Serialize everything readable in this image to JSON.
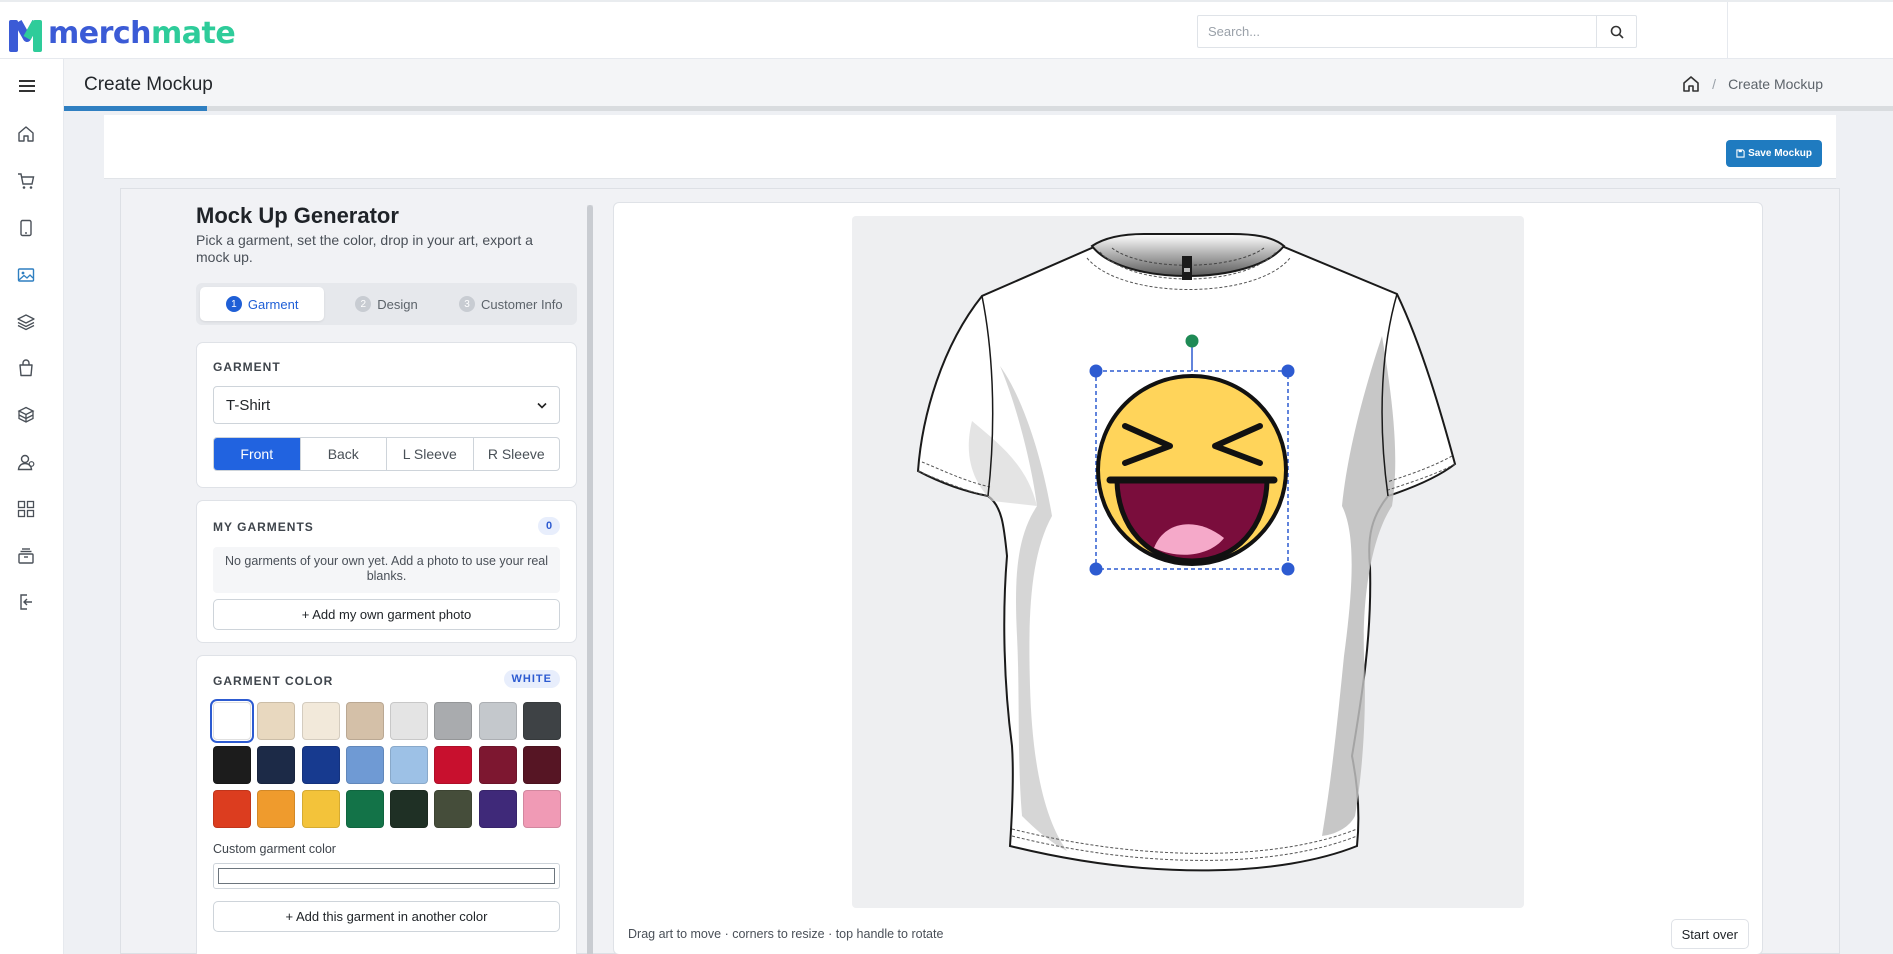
{
  "app": {
    "logo_part1": "merch",
    "logo_part2": "mate",
    "brand_primary": "#3b5bd6",
    "brand_secondary": "#2ecc9a"
  },
  "search": {
    "placeholder": "Search...",
    "icon": "search-icon"
  },
  "sidebar": {
    "items": [
      {
        "icon": "home-icon"
      },
      {
        "icon": "cart-icon"
      },
      {
        "icon": "tablet-icon"
      },
      {
        "icon": "image-icon",
        "active": true
      },
      {
        "icon": "layers-icon"
      },
      {
        "icon": "bag-icon"
      },
      {
        "icon": "stack-icon"
      },
      {
        "icon": "users-icon"
      },
      {
        "icon": "grid-icon"
      },
      {
        "icon": "archive-icon"
      },
      {
        "icon": "logout-icon"
      }
    ]
  },
  "page": {
    "title": "Create Mockup",
    "breadcrumb_home_icon": "home-icon",
    "breadcrumb_current": "Create Mockup",
    "progress_fraction": 0.078
  },
  "toolbar": {
    "save_label": "Save Mockup"
  },
  "generator": {
    "title": "Mock Up Generator",
    "subtitle": "Pick a garment, set the color, drop in your art, export a mock up.",
    "steps": [
      {
        "num": "1",
        "label": "Garment",
        "active": true
      },
      {
        "num": "2",
        "label": "Design"
      },
      {
        "num": "3",
        "label": "Customer Info"
      }
    ]
  },
  "garment": {
    "label": "GARMENT",
    "selected": "T-Shirt",
    "views": [
      "Front",
      "Back",
      "L Sleeve",
      "R Sleeve"
    ],
    "active_view": "Front"
  },
  "my_garments": {
    "label": "MY GARMENTS",
    "count": "0",
    "empty_text": "No garments of your own yet. Add a photo to use your real blanks.",
    "add_button": "+ Add my own garment photo"
  },
  "garment_color": {
    "label": "GARMENT COLOR",
    "selected_name": "WHITE",
    "swatches": [
      "#ffffff",
      "#e8d8bf",
      "#f2e9da",
      "#d4c0a8",
      "#e4e4e4",
      "#a9abae",
      "#c4c8cc",
      "#3e4245",
      "#1c1c1c",
      "#1c2a47",
      "#173a8f",
      "#6f9ad4",
      "#9dc1e6",
      "#c8102e",
      "#7d1730",
      "#561524",
      "#dc3d1f",
      "#ef9b2d",
      "#f3c33a",
      "#137348",
      "#1f3025",
      "#454d3a",
      "#3f2979",
      "#f09ab5"
    ],
    "custom_label": "Custom garment color",
    "add_color_button": "+ Add this garment in another color"
  },
  "canvas": {
    "hint": "Drag art to move · corners to resize · top handle to rotate",
    "start_over": "Start over"
  }
}
